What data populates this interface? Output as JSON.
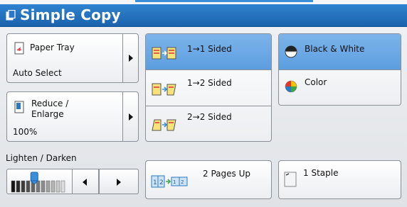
{
  "window": {
    "title": "Simple Copy"
  },
  "paper_tray": {
    "label": "Paper Tray",
    "value": "Auto Select"
  },
  "reduce_enlarge": {
    "label_line1": "Reduce /",
    "label_line2": "Enlarge",
    "value": "100%"
  },
  "lighten_darken": {
    "label": "Lighten / Darken",
    "level_fraction": 0.43
  },
  "sided": {
    "options": [
      {
        "label": "1→1 Sided",
        "selected": true
      },
      {
        "label": "1→2 Sided",
        "selected": false
      },
      {
        "label": "2→2 Sided",
        "selected": false
      }
    ]
  },
  "color_mode": {
    "options": [
      {
        "label": "Black & White",
        "selected": true
      },
      {
        "label": "Color",
        "selected": false
      }
    ]
  },
  "pages_up": {
    "label": "2 Pages Up"
  },
  "staple": {
    "label": "1 Staple"
  },
  "colors": {
    "title_bar": "#1f6cb8",
    "selected": "#6aa8e6",
    "accent": "#3b8fd8"
  }
}
